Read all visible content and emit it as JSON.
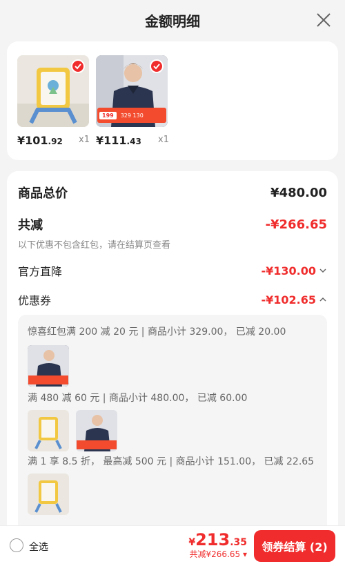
{
  "header": {
    "title": "金额明细"
  },
  "products": [
    {
      "price_main": "¥101",
      "price_dec": ".92",
      "qty": "x1",
      "tag": ""
    },
    {
      "price_main": "¥111",
      "price_dec": ".43",
      "qty": "x1",
      "tag_left": "199",
      "tag_right": "329 130"
    }
  ],
  "summary": {
    "total_label": "商品总价",
    "total_value": "¥480.00",
    "reduce_label": "共减",
    "reduce_value": "-¥266.65",
    "note": "以下优惠不包含红包，请在结算页查看",
    "official_label": "官方直降",
    "official_value": "-¥130.00",
    "coupon_label": "优惠券",
    "coupon_value": "-¥102.65"
  },
  "coupons": [
    {
      "text": "惊喜红包满 200 减 20 元 | 商品小计 329.00，  已减 20.00"
    },
    {
      "text": "满 480 减 60 元 | 商品小计 480.00，  已减 60.00"
    },
    {
      "text": "满 1 享 8.5 折，  最高减 500 元 | 商品小计 151.00，  已减 22.65"
    }
  ],
  "bottom": {
    "select_all": "全选",
    "currency": "¥",
    "amount_main": "213",
    "amount_dec": ".35",
    "saved": "共减¥266.65",
    "checkout": "领券结算 (2)"
  },
  "colors": {
    "accent": "#f02c2c",
    "background": "#f4f4f4"
  }
}
